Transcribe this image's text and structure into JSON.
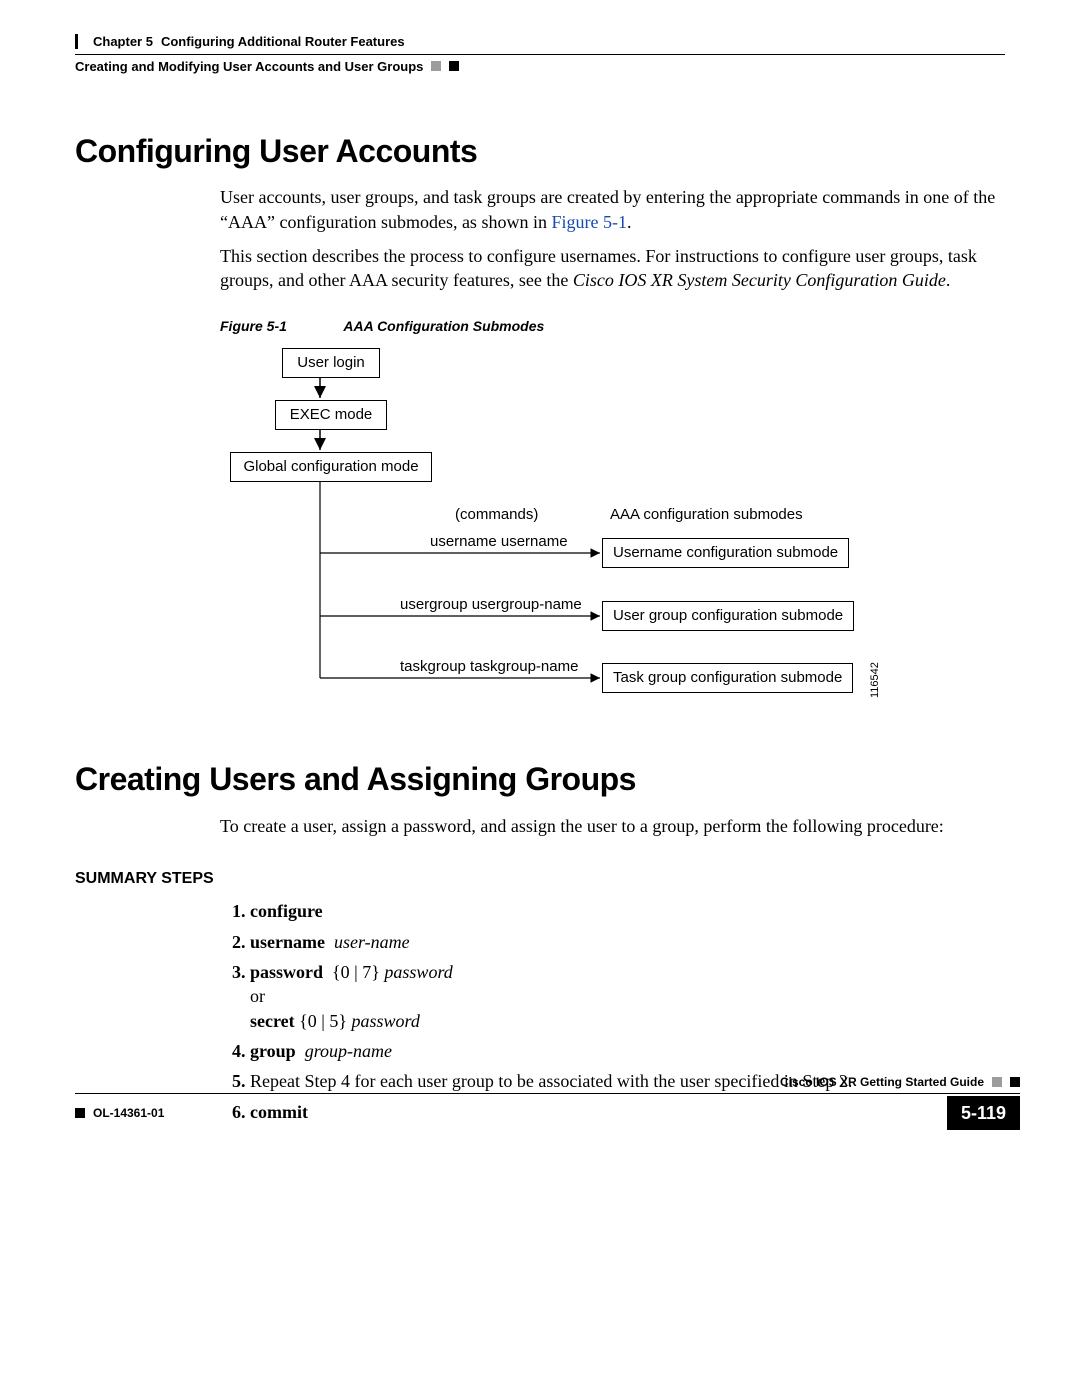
{
  "header": {
    "chapter": "Chapter 5",
    "chapter_title": "Configuring Additional Router Features",
    "section_right": "Creating and Modifying User Accounts and User Groups"
  },
  "h1_a": "Configuring User Accounts",
  "para1_a": "User accounts, user groups, and task groups are created by entering the appropriate commands in one of the “AAA” configuration submodes, as shown in ",
  "para1_link": "Figure 5-1",
  "para1_b": ".",
  "para2_a": "This section describes the process to configure usernames. For instructions to configure user groups, task groups, and other AAA security features, see the ",
  "para2_guide": "Cisco IOS XR System Security Configuration Guide",
  "para2_b": ".",
  "fig": {
    "num": "Figure 5-1",
    "title": "AAA Configuration Submodes"
  },
  "diagram": {
    "b_userlogin": "User login",
    "b_exec": "EXEC mode",
    "b_global": "Global configuration mode",
    "t_commands": "(commands)",
    "t_aaasub": "AAA configuration submodes",
    "c1": "username username",
    "s1": "Username configuration submode",
    "c2": "usergroup usergroup-name",
    "s2": "User group configuration submode",
    "c3": "taskgroup taskgroup-name",
    "s3": "Task group configuration submode",
    "imgid": "116542"
  },
  "h1_b": "Creating Users and Assigning Groups",
  "para3": "To create a user, assign a password, and assign the user to a group, perform the following procedure:",
  "summary_heading": "SUMMARY STEPS",
  "steps": {
    "s1_kw": "configure",
    "s2_kw": "username",
    "s2_arg": "user-name",
    "s3a_kw": "password",
    "s3a_opt": "{0 | 7}",
    "s3a_arg": "password",
    "s3_or": "or",
    "s3b_kw": "secret",
    "s3b_opt": "{0 | 5}",
    "s3b_arg": "password",
    "s4_kw": "group",
    "s4_arg": "group-name",
    "s5": "Repeat Step 4 for each user group to be associated with the user specified in Step 2.",
    "s6_kw": "commit"
  },
  "footer": {
    "guide": "Cisco IOS XR Getting Started Guide",
    "docid": "OL-14361-01",
    "pagenum": "5-119"
  }
}
